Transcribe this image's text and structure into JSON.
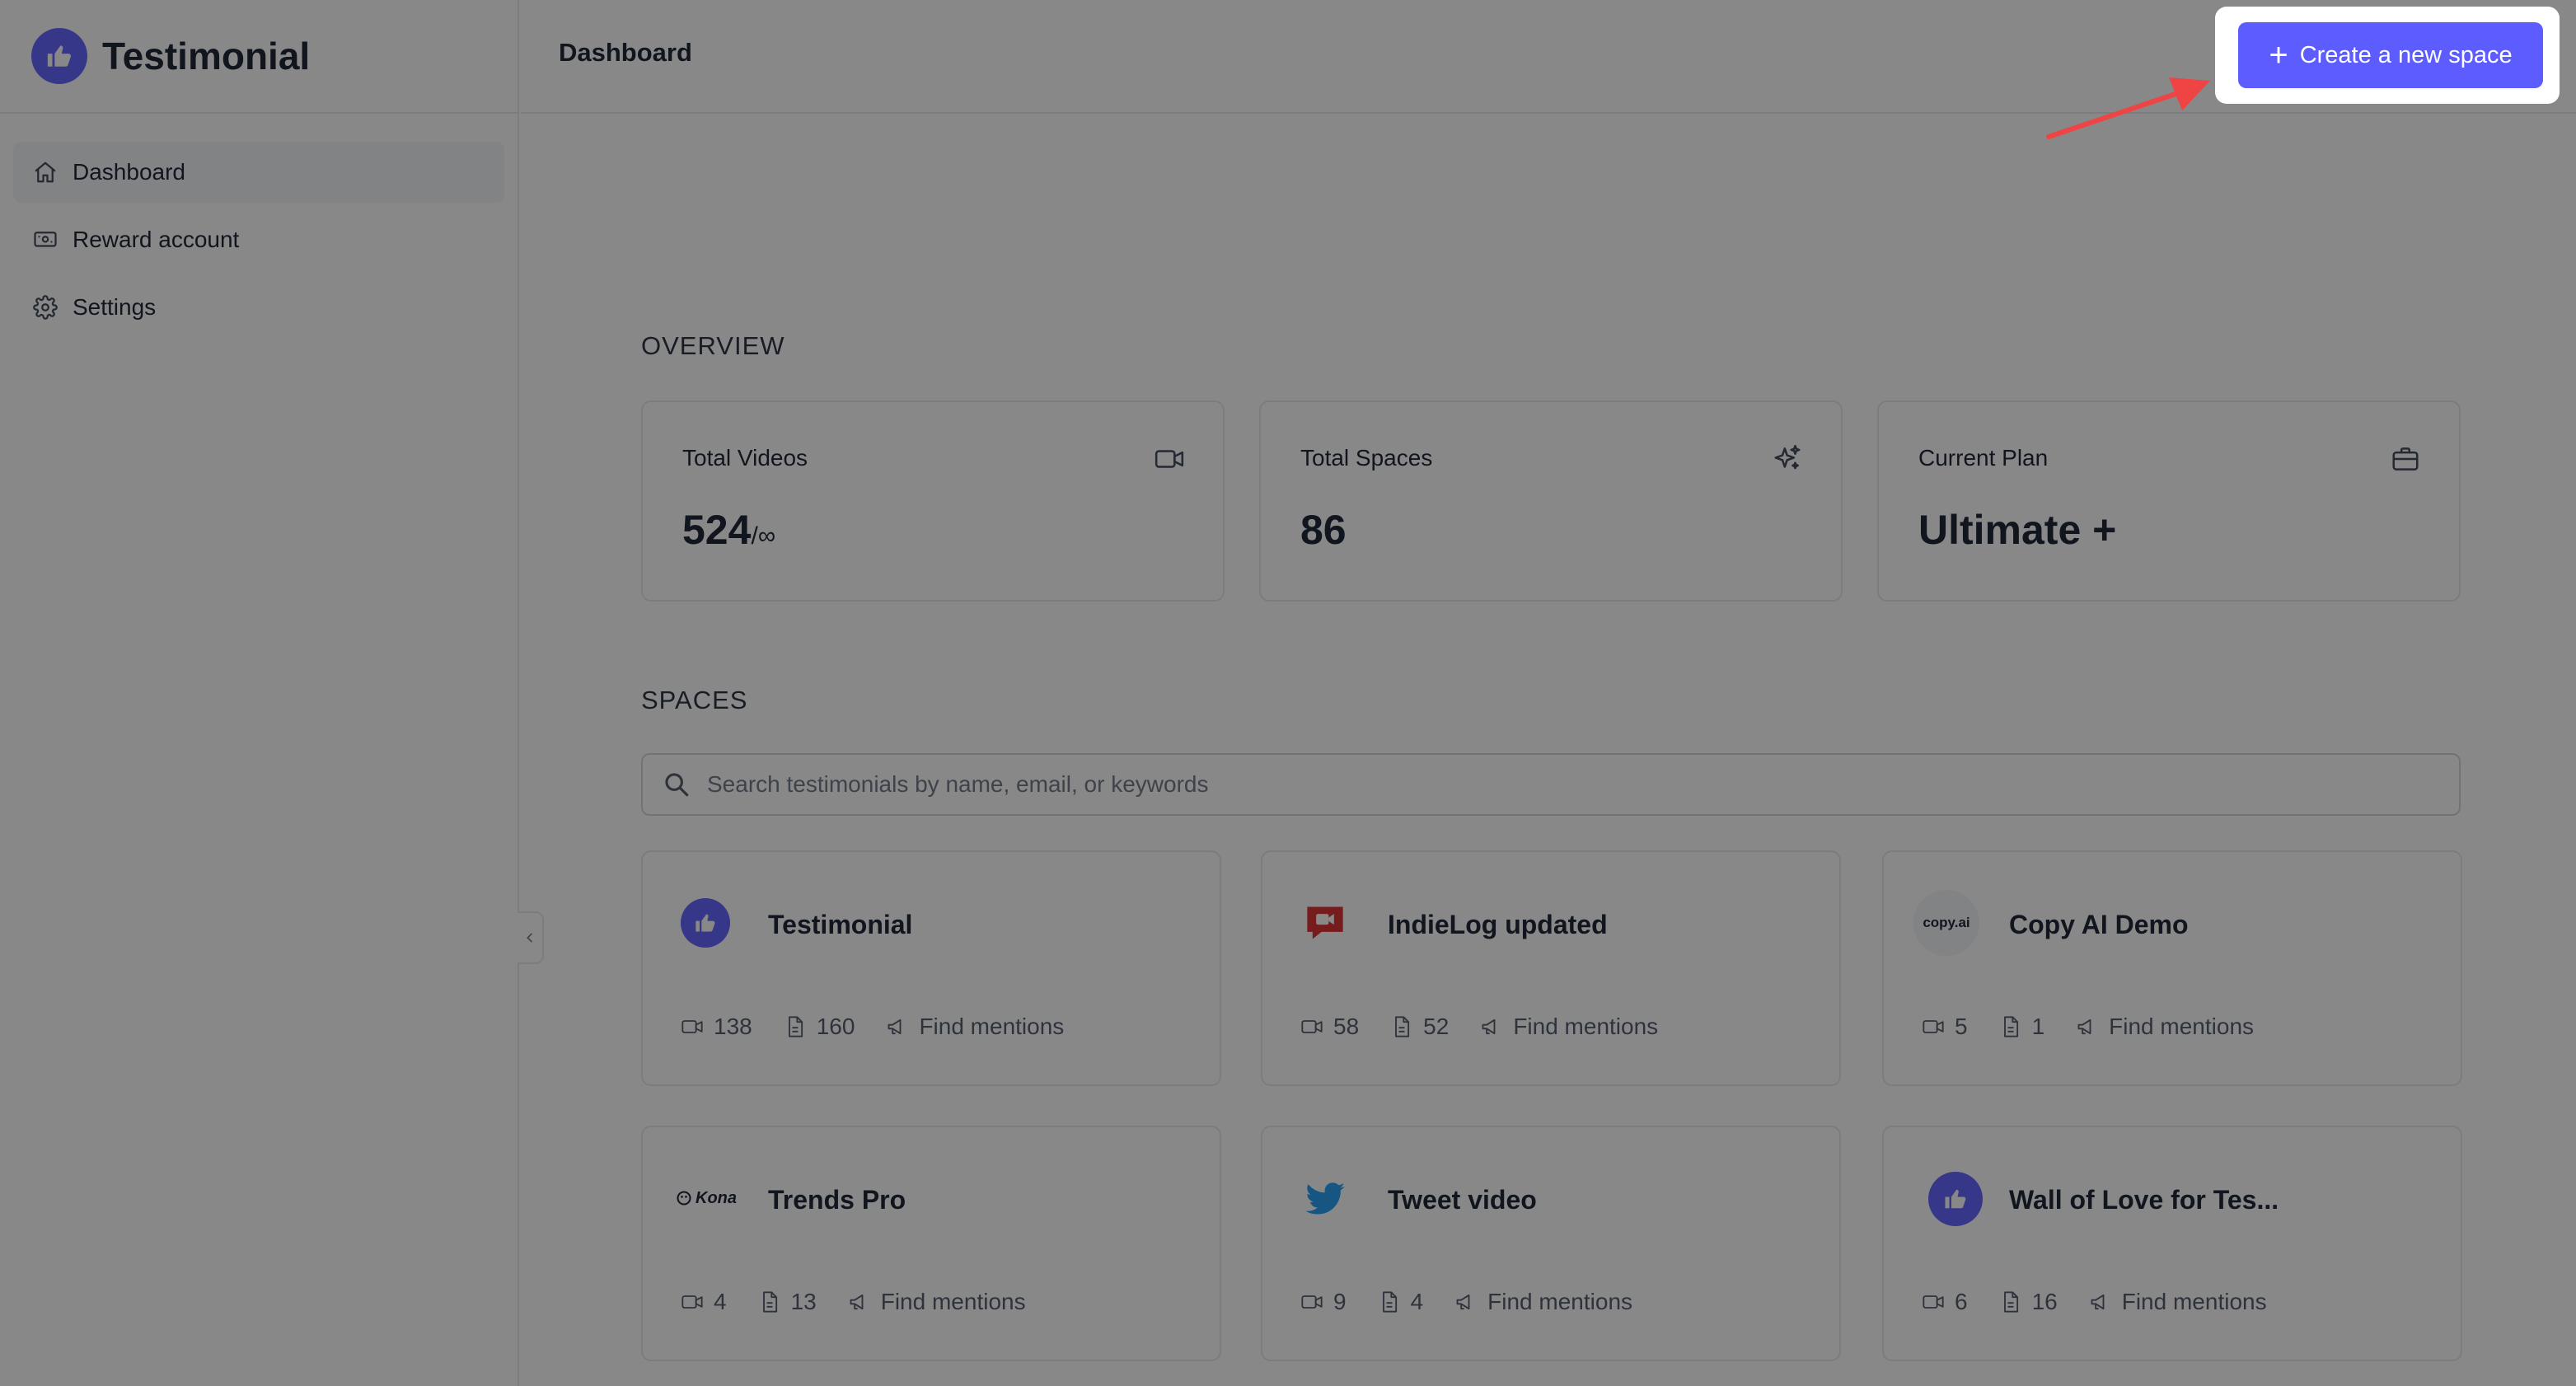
{
  "app": {
    "name": "Testimonial",
    "brand_color": "#5d5dff"
  },
  "sidebar": {
    "items": [
      {
        "label": "Dashboard",
        "icon": "home-icon",
        "active": true
      },
      {
        "label": "Reward account",
        "icon": "banknote-icon",
        "active": false
      },
      {
        "label": "Settings",
        "icon": "gear-icon",
        "active": false
      }
    ]
  },
  "header": {
    "title": "Dashboard",
    "create_button": "Create a new space"
  },
  "overview": {
    "label": "OVERVIEW",
    "cards": [
      {
        "label": "Total Videos",
        "value": "524",
        "suffix": "/∞",
        "icon": "video-icon"
      },
      {
        "label": "Total Spaces",
        "value": "86",
        "suffix": "",
        "icon": "sparkles-icon"
      },
      {
        "label": "Current Plan",
        "value": "Ultimate +",
        "suffix": "",
        "icon": "briefcase-icon"
      }
    ]
  },
  "spaces": {
    "label": "SPACES",
    "search_placeholder": "Search testimonials by name, email, or keywords",
    "find_mentions_label": "Find mentions",
    "items": [
      {
        "name": "Testimonial",
        "videos": "138",
        "texts": "160",
        "logo": "testimonial-logo"
      },
      {
        "name": "IndieLog updated",
        "videos": "58",
        "texts": "52",
        "logo": "indielog-logo"
      },
      {
        "name": "Copy AI Demo",
        "videos": "5",
        "texts": "1",
        "logo": "copyai-logo",
        "logo_text": "copy.ai"
      },
      {
        "name": "Trends Pro",
        "videos": "4",
        "texts": "13",
        "logo": "kona-logo",
        "logo_text": "Kona"
      },
      {
        "name": "Tweet video",
        "videos": "9",
        "texts": "4",
        "logo": "twitter-logo"
      },
      {
        "name": "Wall of Love for Tes...",
        "videos": "6",
        "texts": "16",
        "logo": "testimonial-logo"
      }
    ]
  },
  "annotation": {
    "arrow_color": "#ef4444"
  }
}
